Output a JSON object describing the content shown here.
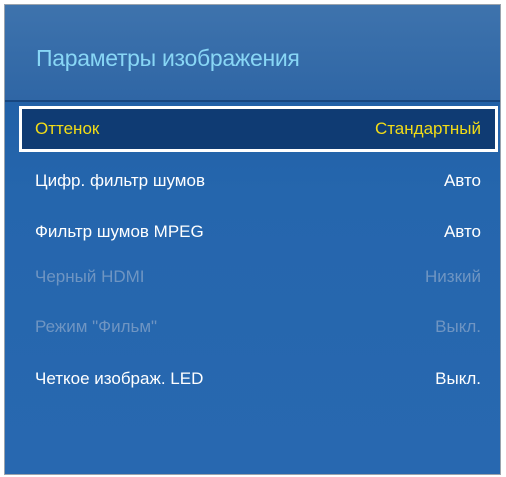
{
  "panel": {
    "title": "Параметры изображения"
  },
  "menu": {
    "items": [
      {
        "label": "Оттенок",
        "value": "Стандартный",
        "state": "selected"
      },
      {
        "label": "Цифр. фильтр шумов",
        "value": "Авто",
        "state": "enabled"
      },
      {
        "label": "Фильтр шумов MPEG",
        "value": "Авто",
        "state": "enabled"
      },
      {
        "label": "Черный HDMI",
        "value": "Низкий",
        "state": "disabled"
      },
      {
        "label": "Режим \"Фильм\"",
        "value": "Выкл.",
        "state": "disabled"
      },
      {
        "label": "Четкое изображ. LED",
        "value": "Выкл.",
        "state": "enabled"
      }
    ]
  },
  "colors": {
    "background": "#2566ad",
    "title": "#88d6f5",
    "selected_text": "#f2dc17",
    "selected_background": "#0f3b73",
    "disabled_text": "#6f95c2"
  }
}
